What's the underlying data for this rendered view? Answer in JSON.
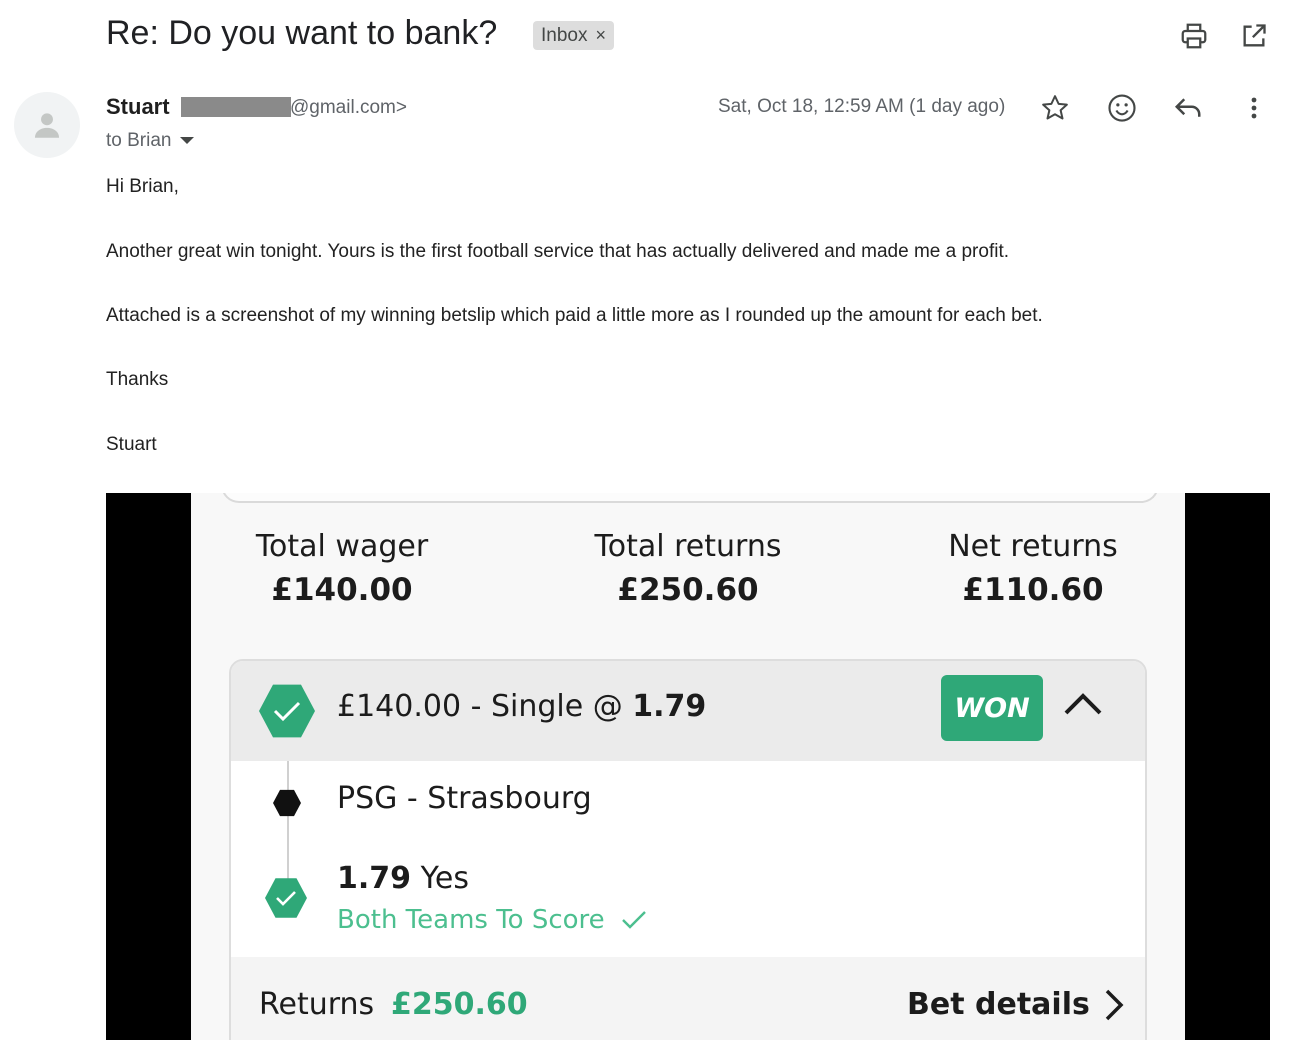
{
  "email": {
    "subject": "Re: Do you want to bank?",
    "label_chip": "Inbox",
    "label_remove": "×",
    "sender_name": "Stuart",
    "sender_email_suffix": "@gmail.com>",
    "to_line": "to Brian",
    "date": "Sat, Oct 18, 12:59 AM (1 day ago)",
    "body": [
      "Hi Brian,",
      "Another great win tonight. Yours is the first football service that has actually delivered and made me a profit.",
      "Attached is a screenshot of my winning betslip which paid a little more as I rounded up the amount for each bet.",
      "Thanks",
      "Stuart"
    ]
  },
  "toolbar_icons": [
    "print-icon",
    "open-in-new-window-icon",
    "star-icon",
    "emoji-icon",
    "reply-icon",
    "more-vert-icon"
  ],
  "betslip": {
    "totals": [
      {
        "label": "Total wager",
        "value": "£140.00"
      },
      {
        "label": "Total returns",
        "value": "£250.60"
      },
      {
        "label": "Net returns",
        "value": "£110.60"
      }
    ],
    "bet_title_prefix": "£140.00 - Single @ ",
    "bet_title_odds": "1.79",
    "status": "WON",
    "match": "PSG - Strasbourg",
    "selection_odds": "1.79",
    "selection": "Yes",
    "market": "Both Teams To Score",
    "returns_label": "Returns",
    "returns_value": "£250.60",
    "details_label": "Bet details"
  },
  "colors": {
    "accent_green": "#2fa878",
    "market_green": "#4cbf8f",
    "chip_bg": "#dddddd"
  }
}
